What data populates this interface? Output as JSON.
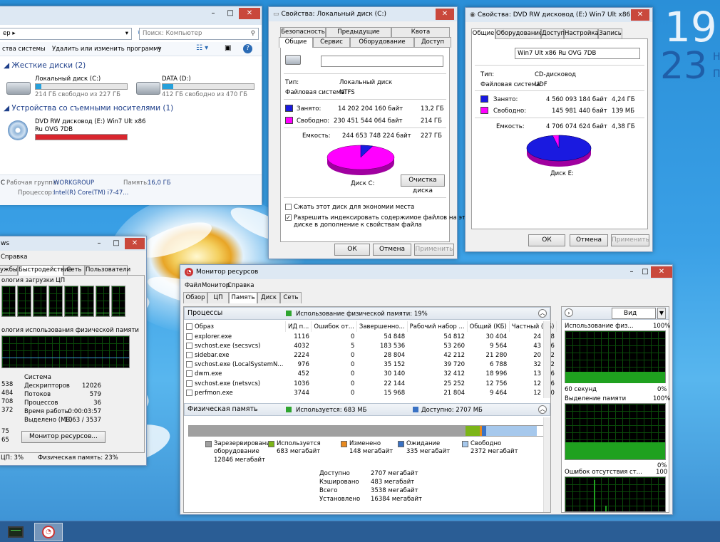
{
  "clock": {
    "time_fragment": "19",
    "date_fragment": "23",
    "sub1": "Н",
    "sub2": "П"
  },
  "explorer": {
    "address": "ер ▸",
    "search_placeholder": "Поиск: Компьютер",
    "toolbar": {
      "sysprops": "ства системы",
      "uninstall": "Удалить или изменить программу",
      "more": "»"
    },
    "hdd_group": "Жесткие диски (2)",
    "removable_group": "Устройства со съемными носителями (1)",
    "drives": [
      {
        "name": "Локальный диск (C:)",
        "free": "214 ГБ свободно из 227 ГБ",
        "used": 0.06
      },
      {
        "name": "DATA (D:)",
        "free": "412 ГБ свободно из 470 ГБ",
        "used": 0.12
      }
    ],
    "dvd": {
      "name": "DVD RW дисковод (E:) Win7 Ult x86",
      "name2": "Ru OVG 7DB",
      "used": 1.0
    },
    "details": {
      "c": "C",
      "workgroup_label": "Рабочая группа:",
      "workgroup": "WORKGROUP",
      "mem_label": "Память:",
      "mem": "16,0 ГБ",
      "cpu_label": "Процессор:",
      "cpu": "Intel(R) Core(TM) i7-47..."
    }
  },
  "propsC": {
    "title": "Свойства: Локальный диск (C:)",
    "tabs_row1": [
      "Безопасность",
      "Предыдущие версии",
      "Квота"
    ],
    "tabs_row2": [
      "Общие",
      "Сервис",
      "Оборудование",
      "Доступ"
    ],
    "type_label": "Тип:",
    "type": "Локальный диск",
    "fs_label": "Файловая система:",
    "fs": "NTFS",
    "used_label": "Занято:",
    "used_bytes": "14 202 204 160 байт",
    "used_h": "13,2 ГБ",
    "free_label": "Свободно:",
    "free_bytes": "230 451 544 064 байт",
    "free_h": "214 ГБ",
    "cap_label": "Емкость:",
    "cap_bytes": "244 653 748 224 байт",
    "cap_h": "227 ГБ",
    "disk_label": "Диск C:",
    "cleanup": "Очистка диска",
    "compress": "Сжать этот диск для экономии места",
    "index1": "Разрешить индексировать содержимое файлов на этом",
    "index2": "диске в дополнение к свойствам файла",
    "ok": "ОК",
    "cancel": "Отмена",
    "apply": "Применить",
    "used_fraction": 0.058,
    "colors": {
      "used": "#1a1ae0",
      "free": "#ff00ff"
    }
  },
  "propsE": {
    "title": "Свойства: DVD RW дисковод (E:) Win7 Ult x86 R...",
    "tabs": [
      "Общие",
      "Оборудование",
      "Доступ",
      "Настройка",
      "Запись"
    ],
    "label": "Win7 Ult x86 Ru OVG 7DB",
    "type_label": "Тип:",
    "type": "CD-дисковод",
    "fs_label": "Файловая система:",
    "fs": "UDF",
    "used_label": "Занято:",
    "used_bytes": "4 560 093 184 байт",
    "used_h": "4,24 ГБ",
    "free_label": "Свободно:",
    "free_bytes": "145 981 440 байт",
    "free_h": "139 МБ",
    "cap_label": "Емкость:",
    "cap_bytes": "4 706 074 624 байт",
    "cap_h": "4,38 ГБ",
    "disk_label": "Диск E:",
    "ok": "ОК",
    "cancel": "Отмена",
    "apply": "Применить",
    "used_fraction": 0.969
  },
  "taskmgr": {
    "title": "ws",
    "menu": "Справка",
    "tabs": [
      "ужбы",
      "Быстродействие",
      "Сеть",
      "Пользователи"
    ],
    "cpu_hist": "ология загрузки ЦП",
    "mem_hist": "ология использования физической памяти",
    "left_vals": [
      "538",
      "484",
      "708",
      "372"
    ],
    "left_vals2": [
      "75",
      "65"
    ],
    "system_header": "Система",
    "system": [
      {
        "k": "Дескрипторов",
        "v": "12026"
      },
      {
        "k": "Потоков",
        "v": "579"
      },
      {
        "k": "Процессов",
        "v": "36"
      },
      {
        "k": "Время работы",
        "v": "0:00:03:57"
      },
      {
        "k": "Выделено (МБ)",
        "v": "1063 / 3537"
      }
    ],
    "resmon_btn": "Монитор ресурсов...",
    "status_cpu": "ЦП: 3%",
    "status_mem": "Физическая память: 23%"
  },
  "resmon": {
    "title": "Монитор ресурсов",
    "menu": [
      "Файл",
      "Монитор",
      "Справка"
    ],
    "tabs": [
      "Обзор",
      "ЦП",
      "Память",
      "Диск",
      "Сеть"
    ],
    "proc_header": "Процессы",
    "proc_usage": "Использование физической памяти: 19%",
    "columns": [
      "Образ",
      "ИД п...",
      "Ошибок от...",
      "Завершенно...",
      "Рабочий набор ...",
      "Общий (КБ)",
      "Частный (КБ)"
    ],
    "rows": [
      [
        "explorer.exe",
        "1116",
        "0",
        "54 848",
        "54 812",
        "30 404",
        "24 408"
      ],
      [
        "svchost.exe (secsvcs)",
        "4032",
        "5",
        "183 536",
        "53 260",
        "9 564",
        "43 696"
      ],
      [
        "sidebar.exe",
        "2224",
        "0",
        "28 804",
        "42 212",
        "21 280",
        "20 932"
      ],
      [
        "svchost.exe (LocalSystemN...",
        "976",
        "0",
        "35 152",
        "39 720",
        "6 788",
        "32 932"
      ],
      [
        "dwm.exe",
        "452",
        "0",
        "30 140",
        "32 412",
        "18 996",
        "13 416"
      ],
      [
        "svchost.exe (netsvcs)",
        "1036",
        "0",
        "22 144",
        "25 252",
        "12 756",
        "12 496"
      ],
      [
        "perfmon.exe",
        "3744",
        "0",
        "15 968",
        "21 804",
        "9 464",
        "12 340"
      ]
    ],
    "phys_header": "Физическая память",
    "phys_used": "Используется: 683 МБ",
    "phys_avail": "Доступно: 2707 МБ",
    "legend": [
      {
        "name": "Зарезервировано оборудование",
        "line1": "Зарезервировани",
        "line2": "оборудование",
        "val": "12846 мегабайт",
        "color": "#a0a0a0"
      },
      {
        "name": "Используется",
        "val": "683 мегабайт",
        "color": "#7cb518"
      },
      {
        "name": "Изменено",
        "val": "148 мегабайт",
        "color": "#e8891e"
      },
      {
        "name": "Ожидание",
        "val": "335 мегабайт",
        "color": "#3a72c4"
      },
      {
        "name": "Свободно",
        "val": "2372 мегабайт",
        "color": "#a6c8ec"
      }
    ],
    "stats": [
      {
        "k": "Доступно",
        "v": "2707 мегабайт"
      },
      {
        "k": "Кэшировано",
        "v": "483 мегабайт"
      },
      {
        "k": "Всего",
        "v": "3538 мегабайт"
      },
      {
        "k": "Установлено",
        "v": "16384 мегабайт"
      }
    ],
    "right": {
      "view": "Вид",
      "g1_title": "Использование физ...",
      "g1_max": "100%",
      "g1_min": "0%",
      "g1_time": "60 секунд",
      "g2_title": "Выделение памяти",
      "g2_max": "100%",
      "g2_min": "0%",
      "g3_title": "Ошибок отсутствия ст...",
      "g3_max": "100"
    }
  }
}
